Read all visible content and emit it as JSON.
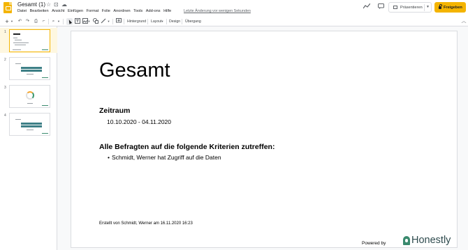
{
  "header": {
    "doc_title": "Gesamt (1)",
    "menu": [
      "Datei",
      "Bearbeiten",
      "Ansicht",
      "Einfügen",
      "Format",
      "Folie",
      "Anordnen",
      "Tools",
      "Add-ons",
      "Hilfe"
    ],
    "last_edit": "Letzte Änderung vor wenigen Sekunden",
    "present_label": "Präsentieren",
    "share_label": "Freigeben",
    "icons": [
      "star-icon",
      "move-folder-icon",
      "cloud-status-icon",
      "activity-trend-icon",
      "comment-history-icon"
    ]
  },
  "toolbar": {
    "background_label": "Hintergrund",
    "layout_label": "Layout",
    "design_label": "Design",
    "transition_label": "Übergang"
  },
  "filmstrip": {
    "slides": [
      {
        "number": "1",
        "active": true
      },
      {
        "number": "2",
        "active": false
      },
      {
        "number": "3",
        "active": false
      },
      {
        "number": "4",
        "active": false
      }
    ]
  },
  "slide": {
    "title": "Gesamt",
    "period_heading": "Zeitraum",
    "period_value": "10.10.2020 - 04.11.2020",
    "criteria_heading": "Alle Befragten auf die folgende Kriterien zutreffen:",
    "criteria_bullet": "•",
    "criteria_item": "Schmidt, Werner hat Zugriff auf die Daten",
    "footer": "Erstellt von Schmidt, Werner am 16.11.2020 16:23",
    "powered_by": "Powered by",
    "brand": "Honestly"
  },
  "colors": {
    "accent": "#f4b400",
    "brand_green": "#3a8a6e",
    "brand_text": "#2f4b4e"
  }
}
